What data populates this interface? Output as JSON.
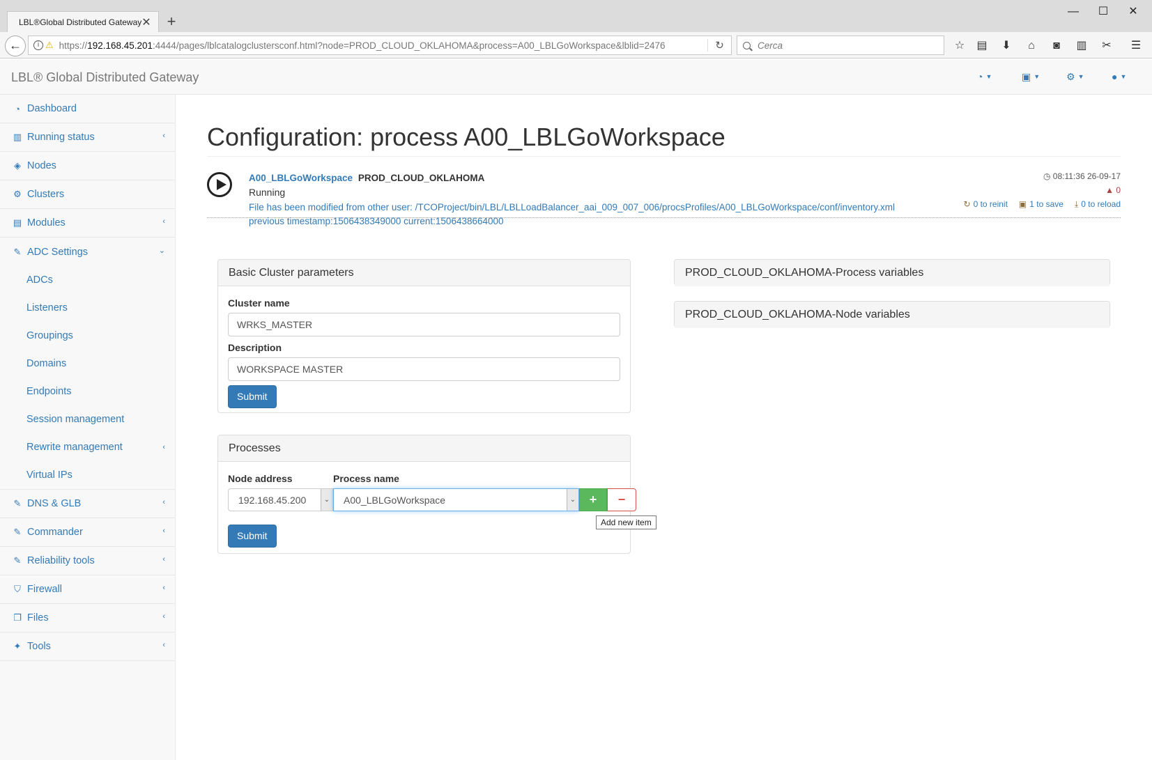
{
  "browser": {
    "tab_title": "LBL®Global Distributed Gateway",
    "url_prefix": "https://",
    "url_host": "192.168.45.201",
    "url_rest": ":4444/pages/lblcatalogclustersconf.html?node=PROD_CLOUD_OKLAHOMA&process=A00_LBLGoWorkspace&lblid=2476",
    "search_placeholder": "Cerca"
  },
  "app": {
    "brand": "LBL® Global Distributed Gateway"
  },
  "sidebar": {
    "items": [
      {
        "label": "Dashboard",
        "icon": "dashboard-icon"
      },
      {
        "label": "Running status",
        "icon": "bar-chart-icon"
      },
      {
        "label": "Nodes",
        "icon": "cube-icon"
      },
      {
        "label": "Clusters",
        "icon": "cogs-icon"
      },
      {
        "label": "Modules",
        "icon": "list-icon"
      },
      {
        "label": "ADC Settings",
        "icon": "edit-icon"
      }
    ],
    "adc_subitems": [
      "ADCs",
      "Listeners",
      "Groupings",
      "Domains",
      "Endpoints",
      "Session management",
      "Rewrite management",
      "Virtual IPs"
    ],
    "bottom_items": [
      {
        "label": "DNS & GLB",
        "icon": "edit-icon"
      },
      {
        "label": "Commander",
        "icon": "edit-icon"
      },
      {
        "label": "Reliability tools",
        "icon": "edit-icon"
      },
      {
        "label": "Firewall",
        "icon": "shield-icon"
      },
      {
        "label": "Files",
        "icon": "files-icon"
      },
      {
        "label": "Tools",
        "icon": "wrench-icon"
      }
    ]
  },
  "page": {
    "title": "Configuration: process A00_LBLGoWorkspace"
  },
  "process": {
    "name": "A00_LBLGoWorkspace",
    "node": "PROD_CLOUD_OKLAHOMA",
    "status": "Running",
    "message_line1": "File has been modified from other user: /TCOProject/bin/LBL/LBLLoadBalancer_aai_009_007_006/procsProfiles/A00_LBLGoWorkspace/conf/inventory.xml",
    "message_line2": "previous timestamp:1506438349000 current:1506438664000",
    "timestamp": "08:11:36 26-09-17",
    "warnings": "0",
    "reinit": "0 to reinit",
    "save": "1 to save",
    "reload": "0 to reload"
  },
  "basic_panel": {
    "heading": "Basic Cluster parameters",
    "cluster_name_label": "Cluster name",
    "cluster_name_value": "WRKS_MASTER",
    "description_label": "Description",
    "description_value": "WORKSPACE MASTER",
    "submit": "Submit"
  },
  "processes_panel": {
    "heading": "Processes",
    "node_address_label": "Node address",
    "process_name_label": "Process name",
    "node_address_value": "192.168.45.200",
    "process_name_value": "A00_LBLGoWorkspace",
    "add_label": "+",
    "remove_label": "−",
    "tooltip": "Add new item",
    "submit": "Submit"
  },
  "right_panels": {
    "process_vars": "PROD_CLOUD_OKLAHOMA-Process variables",
    "node_vars": "PROD_CLOUD_OKLAHOMA-Node variables"
  }
}
